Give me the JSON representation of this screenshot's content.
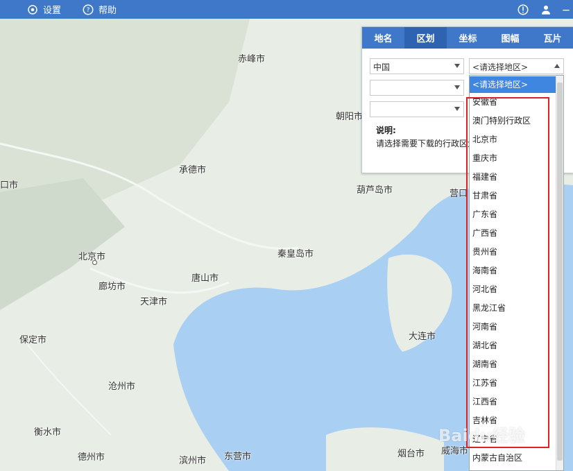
{
  "toolbar": {
    "settings_label": "设置",
    "help_label": "帮助"
  },
  "panel": {
    "tabs": [
      "地名",
      "区划",
      "坐标",
      "图幅",
      "瓦片"
    ],
    "active_tab": "区划",
    "country_select": "中国",
    "region_select": "<请选择地区>",
    "desc_title": "说明:",
    "desc_text": "请选择需要下载的行政区划"
  },
  "dropdown": {
    "selected": "<请选择地区>",
    "options": [
      "安徽省",
      "澳门特别行政区",
      "北京市",
      "重庆市",
      "福建省",
      "甘肃省",
      "广东省",
      "广西省",
      "贵州省",
      "海南省",
      "河北省",
      "黑龙江省",
      "河南省",
      "湖北省",
      "湖南省",
      "江苏省",
      "江西省",
      "吉林省",
      "辽宁省",
      "内蒙古自治区"
    ]
  },
  "map": {
    "cities": [
      "赤峰市",
      "朝阳市",
      "承德市",
      "葫芦岛市",
      "营口",
      "北京市",
      "秦皇岛市",
      "廊坊市",
      "唐山市",
      "天津市",
      "保定市",
      "大连市",
      "沧州市",
      "衡水市",
      "德州市",
      "滨州市",
      "东营市",
      "烟台市",
      "威海市",
      "口市"
    ]
  },
  "watermark": "Baidu经验",
  "colors": {
    "topbar": "#3f78c8",
    "land": "#e8eee6",
    "sea": "#a9cff3",
    "highlight": "#e02020"
  }
}
